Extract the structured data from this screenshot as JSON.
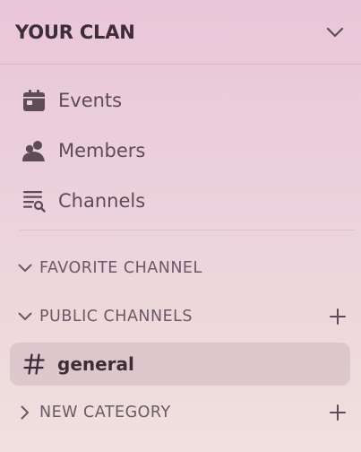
{
  "header": {
    "server_name": "YOUR CLAN",
    "menu_icon": "chevron-down-icon"
  },
  "nav": {
    "items": [
      {
        "label": "Events",
        "icon": "calendar-icon"
      },
      {
        "label": "Members",
        "icon": "members-icon"
      },
      {
        "label": "Channels",
        "icon": "channel-browser-icon"
      }
    ]
  },
  "categories": [
    {
      "label": "FAVORITE CHANNEL",
      "collapsed": false,
      "add": false
    },
    {
      "label": "PUBLIC CHANNELS",
      "collapsed": false,
      "add": true
    },
    {
      "label": "NEW CATEGORY",
      "collapsed": true,
      "add": true
    }
  ],
  "channels": [
    {
      "name": "general",
      "selected": true,
      "icon": "hash-icon"
    }
  ],
  "colors": {
    "text_dark": "#3e2c38",
    "text_muted": "#6a5966",
    "selected_bg": "#d9c3c9"
  }
}
